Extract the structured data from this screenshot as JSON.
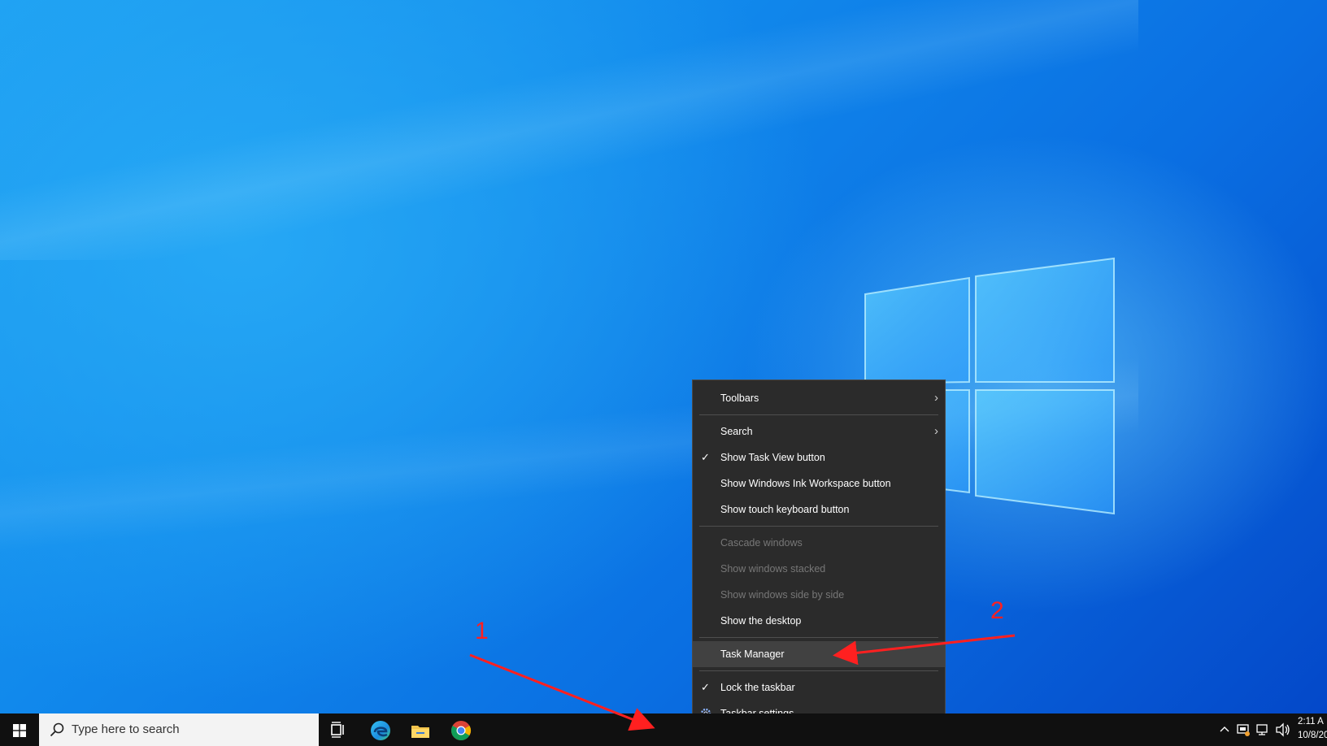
{
  "colors": {
    "menu_bg": "#2b2b2b",
    "menu_highlight": "#414141",
    "taskbar_bg": "#101010",
    "annotation": "#ff2020",
    "desktop_blue": "#0a6fe0"
  },
  "context_menu": {
    "items": [
      {
        "label": "Toolbars",
        "submenu": true
      },
      {
        "label": "Search",
        "submenu": true
      },
      {
        "label": "Show Task View button",
        "checked": true
      },
      {
        "label": "Show Windows Ink Workspace button"
      },
      {
        "label": "Show touch keyboard button"
      },
      {
        "label": "Cascade windows",
        "disabled": true
      },
      {
        "label": "Show windows stacked",
        "disabled": true
      },
      {
        "label": "Show windows side by side",
        "disabled": true
      },
      {
        "label": "Show the desktop"
      },
      {
        "label": "Task Manager",
        "highlighted": true
      },
      {
        "label": "Lock the taskbar",
        "checked": true
      },
      {
        "label": "Taskbar settings",
        "icon": "gear-icon"
      }
    ]
  },
  "taskbar": {
    "search_placeholder": "Type here to search",
    "apps": [
      "task-view-icon",
      "edge-icon",
      "file-explorer-icon",
      "chrome-icon"
    ],
    "tray_icons": [
      "chevron-up-icon",
      "security-icon",
      "network-icon",
      "volume-icon"
    ],
    "clock_time": "2:11 A",
    "clock_date": "10/8/20"
  },
  "annotations": {
    "step1": "1",
    "step2": "2"
  }
}
